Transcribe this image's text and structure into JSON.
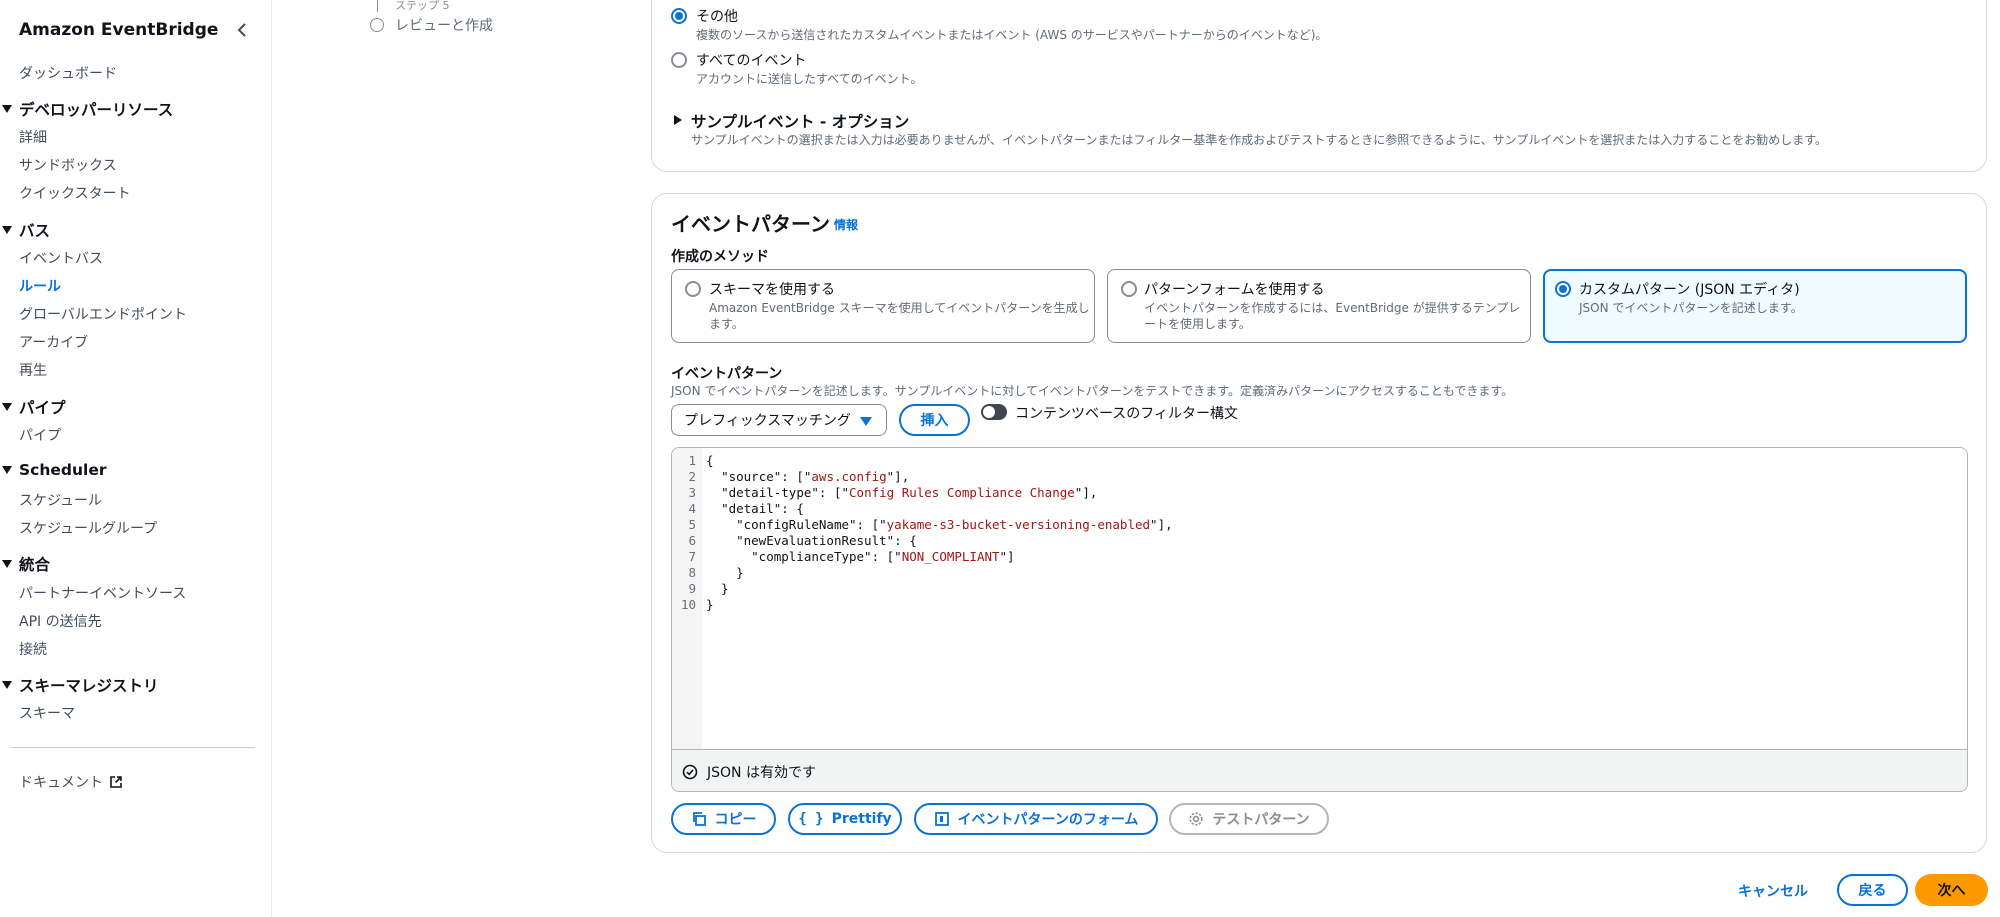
{
  "sidebar": {
    "title": "Amazon EventBridge",
    "dashboard": "ダッシュボード",
    "sections": {
      "developer": {
        "label": "デベロッパーリソース",
        "items": [
          "詳細",
          "サンドボックス",
          "クイックスタート"
        ]
      },
      "bus": {
        "label": "バス",
        "items": [
          "イベントバス",
          "ルール",
          "グローバルエンドポイント",
          "アーカイブ",
          "再生"
        ]
      },
      "pipes": {
        "label": "パイプ",
        "items": [
          "パイプ"
        ]
      },
      "scheduler": {
        "label": "Scheduler",
        "items": [
          "スケジュール",
          "スケジュールグループ"
        ]
      },
      "integration": {
        "label": "統合",
        "items": [
          "パートナーイベントソース",
          "API の送信先",
          "接続"
        ]
      },
      "schema": {
        "label": "スキーマレジストリ",
        "items": [
          "スキーマ"
        ]
      }
    },
    "active_item": "ルール",
    "documentation": "ドキュメント"
  },
  "wizard": {
    "step5_caption": "ステップ 5",
    "review_label": "レビューと作成"
  },
  "event_source": {
    "other_title": "その他",
    "other_desc": "複数のソースから送信されたカスタムイベントまたはイベント (AWS のサービスやパートナーからのイベントなど)。",
    "all_title": "すべてのイベント",
    "all_desc": "アカウントに送信したすべてのイベント。",
    "sample_title": "サンプルイベント - オプション",
    "sample_desc": "サンプルイベントの選択または入力は必要ありませんが、イベントパターンまたはフィルター基準を作成およびテストするときに参照できるように、サンプルイベントを選択または入力することをお勧めします。"
  },
  "pattern": {
    "heading": "イベントパターン",
    "info": "情報",
    "method_label": "作成のメソッド",
    "methods": [
      {
        "title": "スキーマを使用する",
        "desc1": "Amazon EventBridge スキーマを使用してイベントパターンを生成し",
        "desc2": "ます。"
      },
      {
        "title": "パターンフォームを使用する",
        "desc1": "イベントパターンを作成するには、EventBridge が提供するテンプレ",
        "desc2": "ートを使用します。"
      },
      {
        "title": "カスタムパターン (JSON エディタ)",
        "desc1": "JSON でイベントパターンを記述します。",
        "desc2": ""
      }
    ],
    "editor_label": "イベントパターン",
    "editor_desc": "JSON でイベントパターンを記述します。サンプルイベントに対してイベントパターンをテストできます。定義済みパターンにアクセスすることもできます。",
    "select_value": "プレフィックスマッチング",
    "insert_label": "挿入",
    "toggle_label": "コンテンツベースのフィルター構文",
    "code_lines": [
      "{",
      "  \"source\": [\"aws.config\"],",
      "  \"detail-type\": [\"Config Rules Compliance Change\"],",
      "  \"detail\": {",
      "    \"configRuleName\": [\"yakame-s3-bucket-versioning-enabled\"],",
      "    \"newEvaluationResult\": {",
      "      \"complianceType\": [\"NON_COMPLIANT\"]",
      "    }",
      "  }",
      "}"
    ],
    "line_numbers": [
      "1",
      "2",
      "3",
      "4",
      "5",
      "6",
      "7",
      "8",
      "9",
      "10"
    ],
    "status": "JSON は有効です",
    "buttons": {
      "copy": "コピー",
      "prettify": "Prettify",
      "form": "イベントパターンのフォーム",
      "test": "テストパターン"
    }
  },
  "footer": {
    "cancel": "キャンセル",
    "back": "戻る",
    "next": "次へ"
  },
  "colors": {
    "accent": "#0972d3",
    "primary_button": "#ff9900",
    "string_literal": "#a31515"
  }
}
